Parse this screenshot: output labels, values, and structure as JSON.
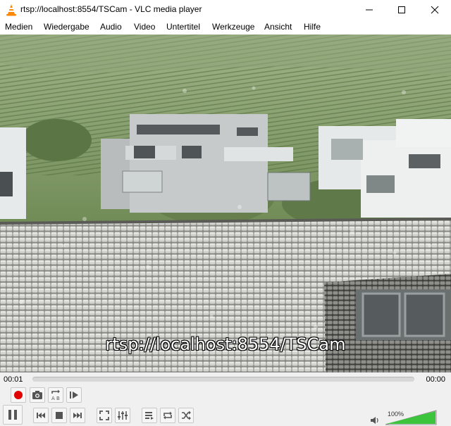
{
  "window": {
    "title": "rtsp://localhost:8554/TSCam - VLC media player"
  },
  "menu": {
    "items": [
      "Medien",
      "Wiedergabe",
      "Audio",
      "Video",
      "Untertitel",
      "Werkzeuge",
      "Ansicht",
      "Hilfe"
    ]
  },
  "video": {
    "subtitle_text": "rtsp://localhost:8554/TSCam"
  },
  "seek": {
    "elapsed": "00:01",
    "total": "00:00",
    "position": 0
  },
  "volume": {
    "percent_label": "100%",
    "level": 1.0
  },
  "icons": {
    "record": "record-icon",
    "snapshot": "camera-icon",
    "loop_ab": "loop-ab-icon",
    "frame_step": "frame-step-icon",
    "pause": "pause-icon",
    "previous": "skip-previous-icon",
    "stop": "stop-icon",
    "next": "skip-next-icon",
    "fullscreen": "fullscreen-icon",
    "extended_settings": "equalizer-icon",
    "playlist": "playlist-icon",
    "loop": "loop-icon",
    "random": "shuffle-icon",
    "volume": "speaker-icon"
  },
  "colors": {
    "record": "#e00000",
    "volume_fill": "#3cc53c",
    "vlc_orange": "#ff8800"
  }
}
